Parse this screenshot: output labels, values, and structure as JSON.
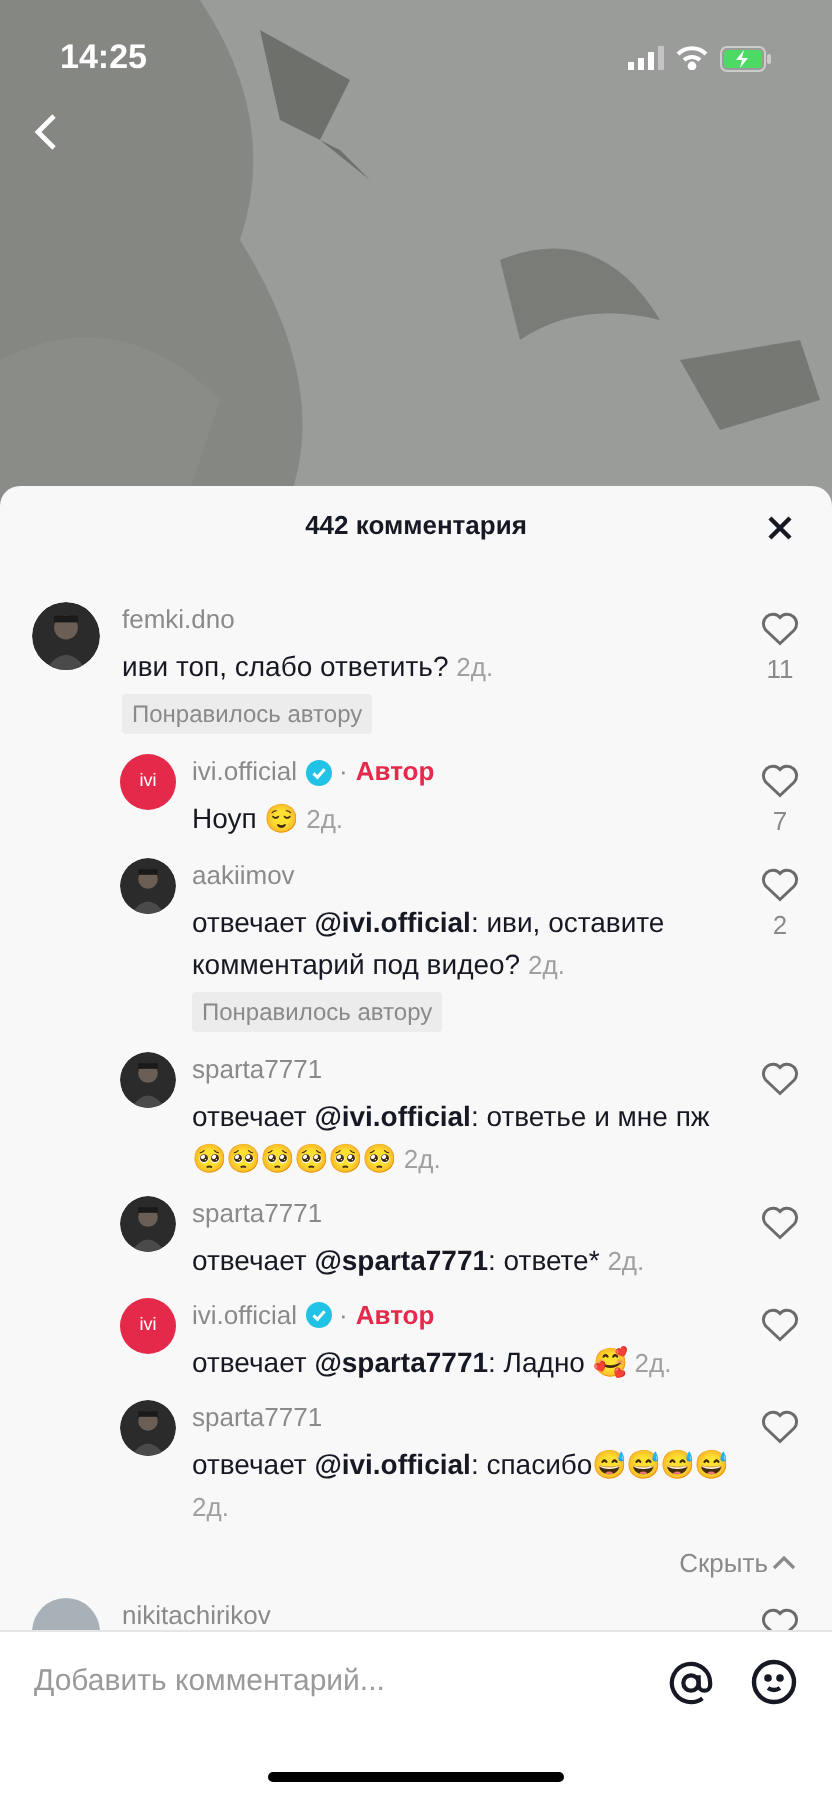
{
  "status_bar": {
    "time": "14:25"
  },
  "sheet": {
    "title": "442 комментария"
  },
  "comments": [
    {
      "user": "femki.dno",
      "text": "иви топ, слабо ответить?",
      "time": "2д.",
      "likes": "11",
      "liked_by_author": "Понравилось автору",
      "replies": [
        {
          "user": "ivi.official",
          "avatar": {
            "kind": "logo",
            "text": "ivi"
          },
          "verified": true,
          "separator": "·",
          "author_label": "Автор",
          "text": "Ноуп 😌",
          "time": "2д.",
          "likes": "7"
        },
        {
          "user": "aakiimov",
          "text": "отвечает **@ivi.official**: иви, оставите комментарий под видео?",
          "time": "2д.",
          "likes": "2",
          "liked_by_author": "Понравилось автору"
        },
        {
          "user": "sparta7771",
          "text": "отвечает **@ivi.official**: ответье и мне пж 🥺🥺🥺🥺🥺🥺",
          "time": "2д."
        },
        {
          "user": "sparta7771",
          "text": "отвечает **@sparta7771**: ответе*",
          "time": "2д."
        },
        {
          "user": "ivi.official",
          "avatar": {
            "kind": "logo",
            "text": "ivi"
          },
          "verified": true,
          "separator": "·",
          "author_label": "Автор",
          "text": "отвечает **@sparta7771**: Ладно 🥰",
          "time": "2д."
        },
        {
          "user": "sparta7771",
          "text": "отвечает **@ivi.official**: спасибо😅😅😅😅",
          "time": "2д."
        }
      ],
      "hide_label": "Скрыть"
    },
    {
      "user": "nikitachirikov",
      "avatar": {
        "kind": "blank"
      }
    }
  ],
  "input": {
    "placeholder": "Добавить комментарий..."
  }
}
